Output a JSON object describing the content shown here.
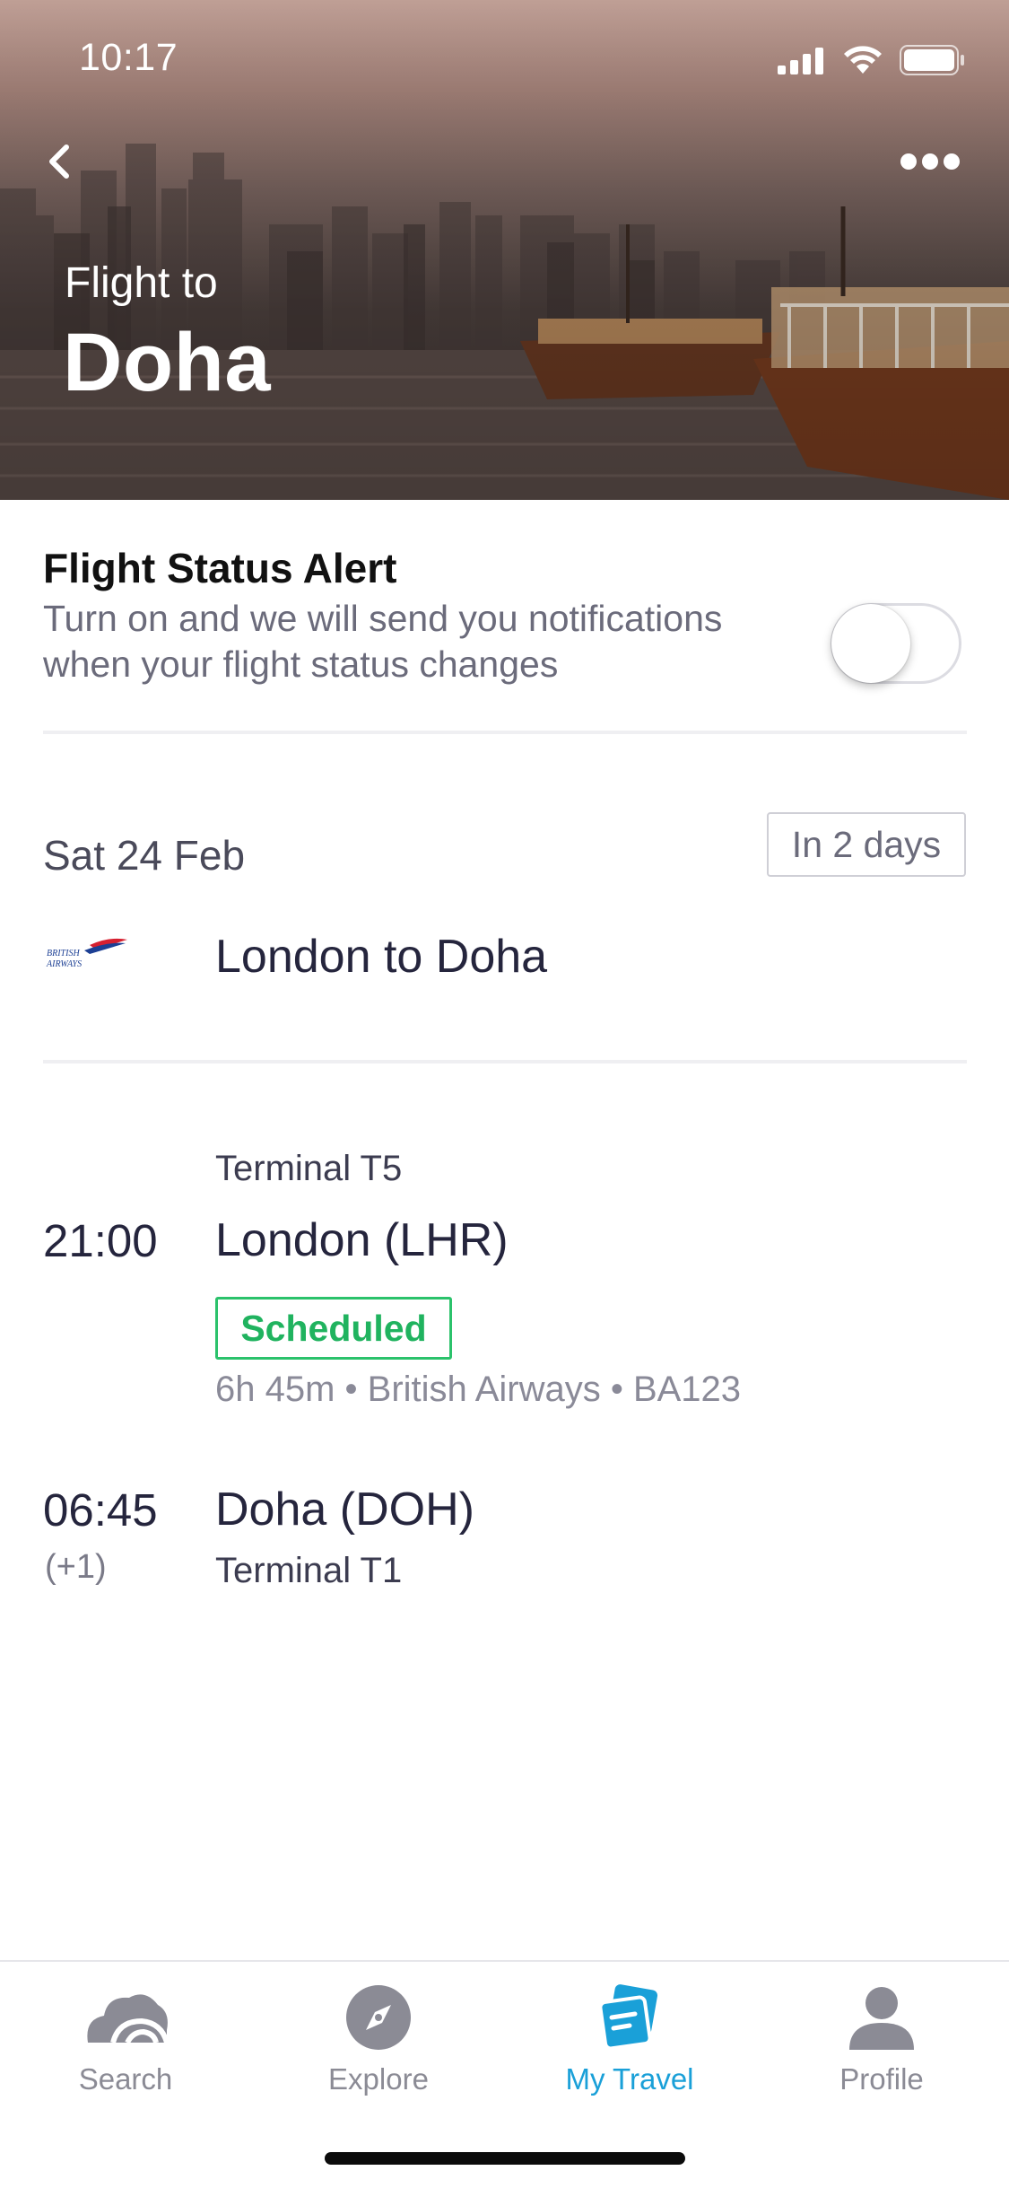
{
  "status_bar": {
    "time": "10:17",
    "icons": [
      "signal-icon",
      "wifi-icon",
      "battery-icon"
    ]
  },
  "header": {
    "subtitle": "Flight to",
    "title": "Doha",
    "back_icon": "chevron-left-icon",
    "more_icon": "more-dots-icon"
  },
  "alert": {
    "title": "Flight Status Alert",
    "description": "Turn on and we will send you notifications when your flight status changes",
    "toggle_on": false
  },
  "trip": {
    "date": "Sat 24 Feb",
    "countdown": "In 2 days",
    "airline_logo": "british-airways-logo",
    "route": "London to Doha"
  },
  "departure": {
    "terminal": "Terminal T5",
    "time": "21:00",
    "city": "London (LHR)",
    "status": "Scheduled",
    "details": "6h 45m • British Airways • BA123"
  },
  "arrival": {
    "time": "06:45",
    "day_offset": "(+1)",
    "city": "Doha (DOH)",
    "terminal": "Terminal T1"
  },
  "tabbar": {
    "tabs": [
      {
        "label": "Search",
        "icon": "search-cloud-icon",
        "active": false
      },
      {
        "label": "Explore",
        "icon": "compass-icon",
        "active": false
      },
      {
        "label": "My Travel",
        "icon": "my-travel-icon",
        "active": true
      },
      {
        "label": "Profile",
        "icon": "profile-icon",
        "active": false
      }
    ]
  },
  "colors": {
    "accent": "#1aa0d8",
    "status_green": "#20b35f",
    "text_dark": "#25253d",
    "text_muted": "#8a8a98"
  }
}
